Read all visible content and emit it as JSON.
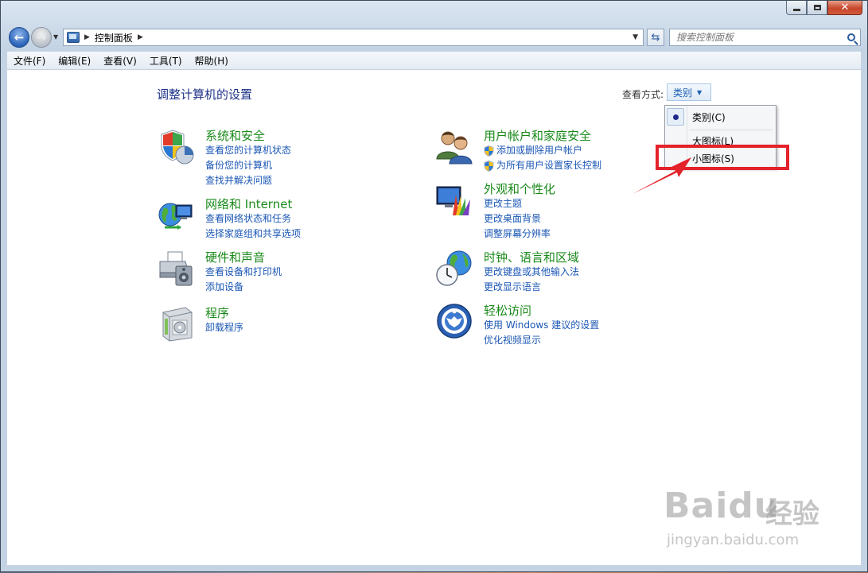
{
  "nav": {
    "breadcrumb": "控制面板",
    "search_placeholder": "搜索控制面板"
  },
  "menu": [
    "文件(F)",
    "编辑(E)",
    "查看(V)",
    "工具(T)",
    "帮助(H)"
  ],
  "main": {
    "title": "调整计算机的设置",
    "viewby_label": "查看方式:",
    "viewby_value": "类别"
  },
  "categories": [
    {
      "title": "系统和安全",
      "icon": "shield-icon",
      "links": [
        "查看您的计算机状态",
        "备份您的计算机",
        "查找并解决问题"
      ]
    },
    {
      "title": "网络和 Internet",
      "icon": "network-globe-icon",
      "links": [
        "查看网络状态和任务",
        "选择家庭组和共享选项"
      ]
    },
    {
      "title": "硬件和声音",
      "icon": "printer-speaker-icon",
      "links": [
        "查看设备和打印机",
        "添加设备"
      ]
    },
    {
      "title": "程序",
      "icon": "programs-box-icon",
      "links": [
        "卸载程序"
      ]
    },
    {
      "title": "用户帐户和家庭安全",
      "icon": "users-icon",
      "links": [
        "添加或删除用户帐户",
        "为所有用户设置家长控制"
      ]
    },
    {
      "title": "外观和个性化",
      "icon": "monitor-palette-icon",
      "links": [
        "更改主题",
        "更改桌面背景",
        "调整屏幕分辨率"
      ]
    },
    {
      "title": "时钟、语言和区域",
      "icon": "clock-globe-icon",
      "links": [
        "更改键盘或其他输入法",
        "更改显示语言"
      ]
    },
    {
      "title": "轻松访问",
      "icon": "ease-of-access-icon",
      "links": [
        "使用 Windows 建议的设置",
        "优化视频显示"
      ]
    }
  ],
  "viewby_menu": {
    "items": [
      "类别(C)",
      "大图标(L)",
      "小图标(S)"
    ],
    "selected": "类别(C)"
  },
  "watermark": {
    "brand": "Baidu",
    "brand_cn": "经验",
    "url": "jingyan.baidu.com"
  },
  "colors": {
    "category_title": "#1a8a1a",
    "link": "#1b57b5",
    "page_title": "#1e3287",
    "annotation": "#e3222a"
  }
}
